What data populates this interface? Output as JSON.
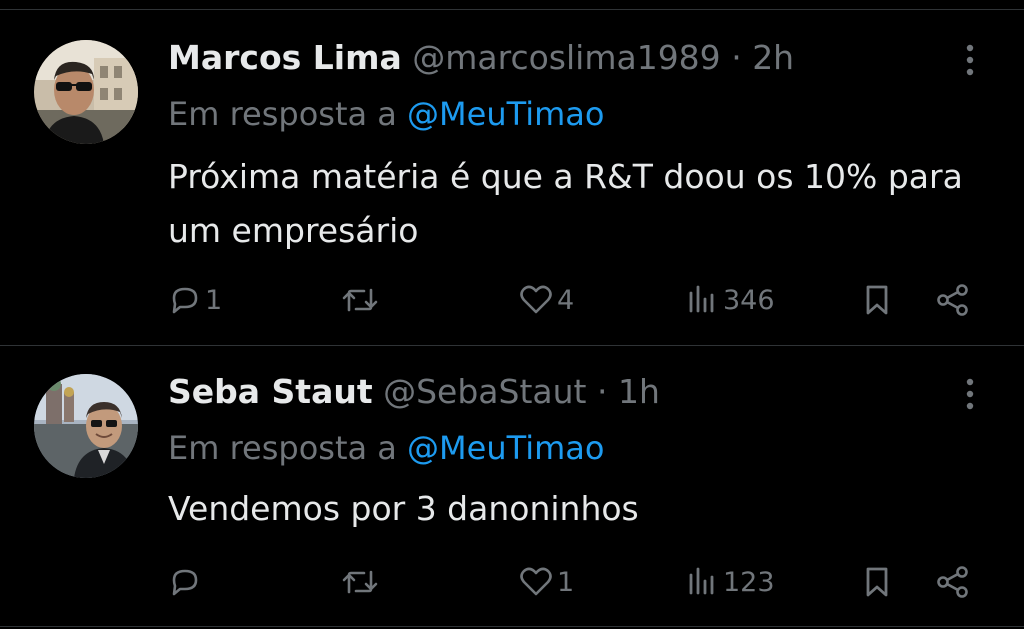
{
  "tweets": [
    {
      "name": "Marcos Lima",
      "handle": "@marcoslima1989",
      "separator": "·",
      "time": "2h",
      "reply_prefix": "Em resposta a",
      "reply_to": "@MeuTimao",
      "text": "Próxima matéria é que a R&T doou os 10% para um empresário",
      "replies": "1",
      "retweets": "",
      "likes": "4",
      "views": "346"
    },
    {
      "name": "Seba Staut",
      "handle": "@SebaStaut",
      "separator": "·",
      "time": "1h",
      "reply_prefix": "Em resposta a",
      "reply_to": "@MeuTimao",
      "text": "Vendemos por 3 danoninhos",
      "replies": "",
      "retweets": "",
      "likes": "1",
      "views": "123"
    }
  ],
  "colors": {
    "background": "#000000",
    "text": "#e7e9ea",
    "secondary": "#71767b",
    "accent": "#1d9bf0",
    "divider": "#2f3336"
  },
  "icons": [
    "more-icon",
    "reply-icon",
    "retweet-icon",
    "like-icon",
    "views-icon",
    "bookmark-icon",
    "share-icon"
  ]
}
